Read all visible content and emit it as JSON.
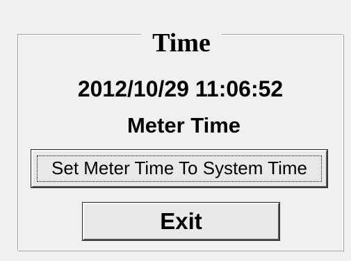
{
  "dialog": {
    "group_title": "Time",
    "datetime_value": "2012/10/29 11:06:52",
    "meter_time_label": "Meter Time",
    "set_time_button_label": "Set Meter Time To System Time",
    "exit_button_label": "Exit"
  }
}
